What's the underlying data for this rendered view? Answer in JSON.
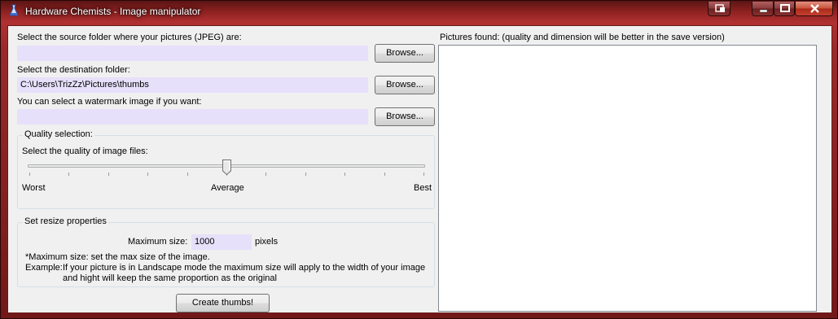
{
  "window": {
    "title": "Hardware Chemists - Image manipulator"
  },
  "titlebar_buttons": {
    "extra": "window-switch-icon",
    "minimize": "minimize-icon",
    "maximize": "maximize-icon",
    "close": "close-icon"
  },
  "source": {
    "label": "Select the source folder where your pictures (JPEG) are:",
    "value": "",
    "browse": "Browse..."
  },
  "destination": {
    "label": "Select the destination folder:",
    "value": "C:\\Users\\TrizZz\\Pictures\\thumbs",
    "browse": "Browse..."
  },
  "watermark": {
    "label": "You can select a watermark image if you want:",
    "value": "",
    "browse": "Browse..."
  },
  "quality": {
    "legend": "Quality selection:",
    "label": "Select the quality of image files:",
    "worst": "Worst",
    "average": "Average",
    "best": "Best",
    "level": 0.5
  },
  "resize": {
    "legend": "Set resize properties",
    "max_label": "Maximum size:",
    "max_value": "1000",
    "unit": "pixels",
    "note": "*Maximum size: set the max size of the image.",
    "example_prefix": "Example:",
    "example_line1": "If your picture is in Landscape mode the maximum size will apply to the width of your image",
    "example_line2": "and hight will keep the same proportion as the original"
  },
  "create_button": "Create thumbs!",
  "pictures": {
    "label": "Pictures found: (quality and dimension will be better in the save version)"
  },
  "colors": {
    "field_bg": "#e6e0fa",
    "titlebar": "#9a2a2a"
  }
}
